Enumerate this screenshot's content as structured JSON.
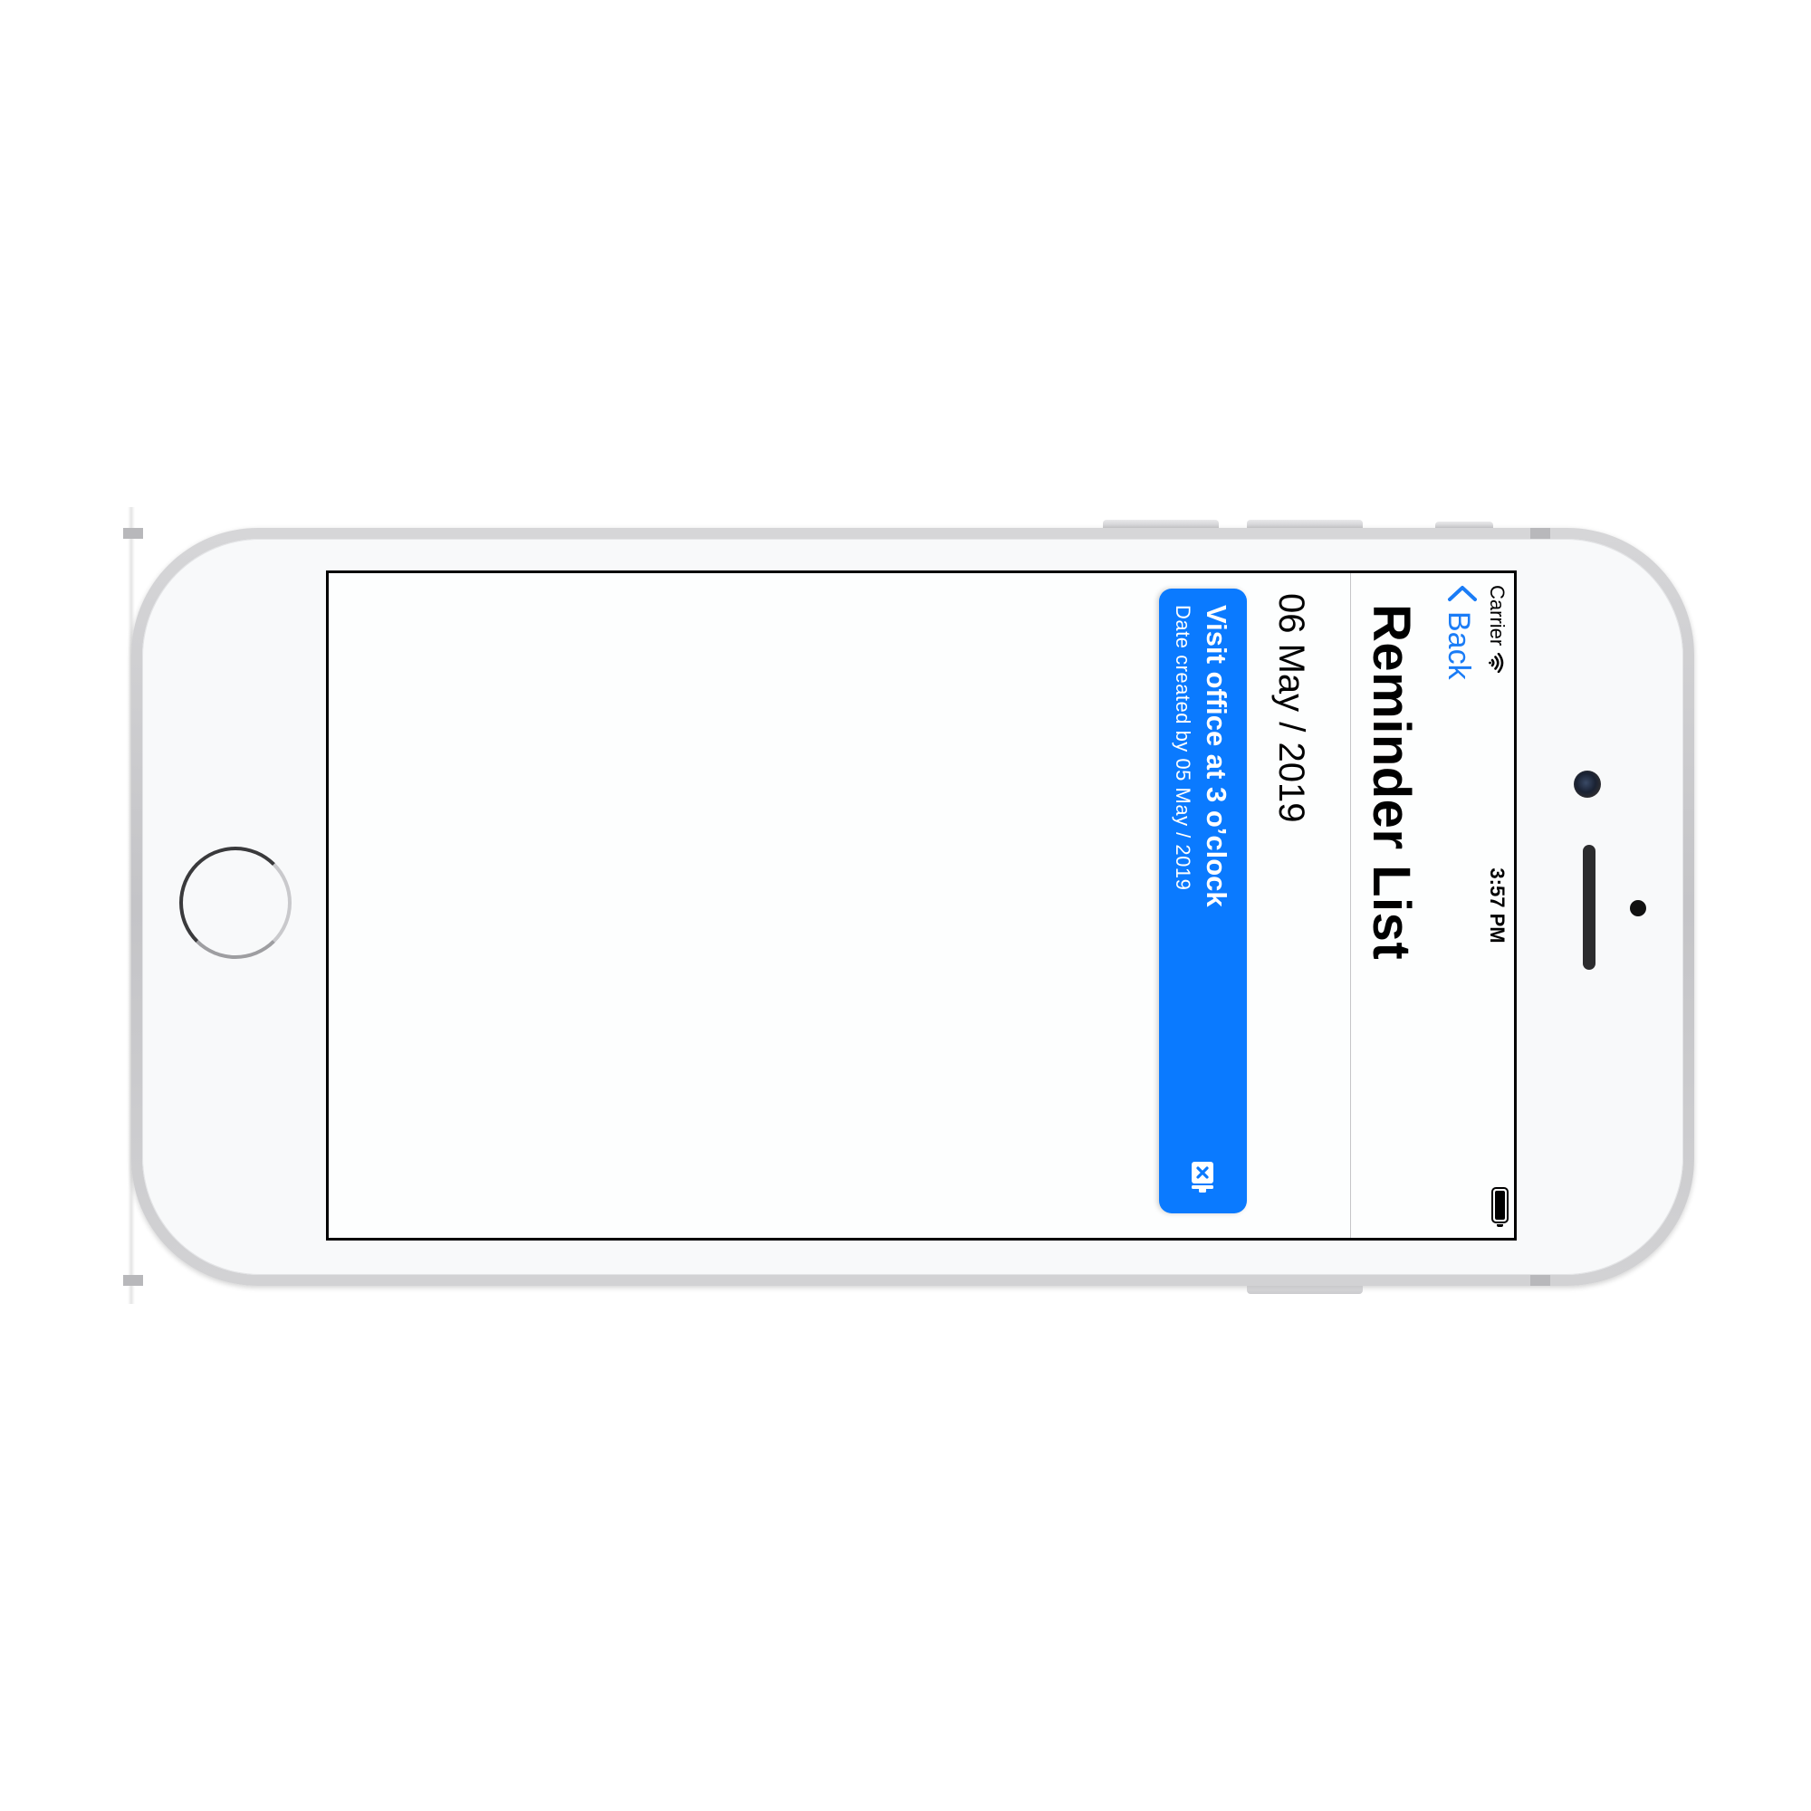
{
  "status_bar": {
    "carrier": "Carrier",
    "time": "3:57 PM",
    "wifi_icon": "wifi-icon",
    "battery_icon": "battery-icon"
  },
  "nav": {
    "back_label": "Back",
    "back_icon": "chevron-left-icon",
    "title": "Reminder List"
  },
  "section": {
    "date": "06 May / 2019"
  },
  "reminders": [
    {
      "title": "Visit office at 3 o’clock",
      "subtitle": "Date created by 05 May / 2019",
      "action_icon": "delete-icon"
    }
  ],
  "colors": {
    "accent": "#1a7cf6",
    "card": "#0a7aff",
    "card_text": "#ffffff",
    "screen_bg": "#fdfefe"
  }
}
